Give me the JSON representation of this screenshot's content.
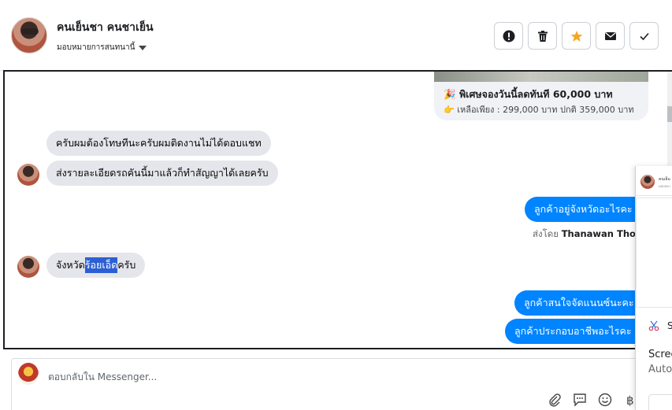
{
  "header": {
    "contact_name": "คนเย็นชา คนชาเย็น",
    "assign_label": "มอบหมายการสนทนานี้",
    "actions": [
      {
        "name": "report-button",
        "icon": "alert-icon"
      },
      {
        "name": "delete-button",
        "icon": "trash-icon"
      },
      {
        "name": "star-button",
        "icon": "star-icon"
      },
      {
        "name": "mail-button",
        "icon": "envelope-icon"
      },
      {
        "name": "done-button",
        "icon": "check-icon"
      }
    ]
  },
  "promo": {
    "title_emoji": "🎉",
    "title": "พิเศษจองวันนี้ลดทันที 60,000 บาท",
    "price_emoji": "👉",
    "price": "เหลือเพียง : 299,000 บาท ปกติ 359,000 บาท"
  },
  "messages": {
    "in1": "ครับผมต้องโทษทีนะครับผมติดงานไม่ได้ตอบแชท",
    "in2": "ส่งรายละเอียดรถคันนี้มาแล้วก็ทำสัญญาได้เลยครับ",
    "out1": "ลูกค้าอยู่จังหวัดอะไรคะ",
    "sent_by_label": "ส่งโดย",
    "sent_by_name": "Thanawan Thon",
    "in3_before": "จังหวัด",
    "in3_selected": "ร้อยเอ็ด",
    "in3_after": "ครับ",
    "out2": "ลูกค้าสนใจจัดแนนซ์นะคะ",
    "out3": "ลูกค้าประกอบอาชีพอะไรคะ"
  },
  "composer": {
    "placeholder": "ตอบกลับใน Messenger..."
  },
  "panel": {
    "name": "คนเย็น",
    "sub": "มอบหมา",
    "snip_letter": "S",
    "line1": "Scree",
    "line2": "Auto"
  },
  "colors": {
    "outgoing": "#0084ff",
    "incoming": "#e4e6eb",
    "star": "#f5a623"
  }
}
